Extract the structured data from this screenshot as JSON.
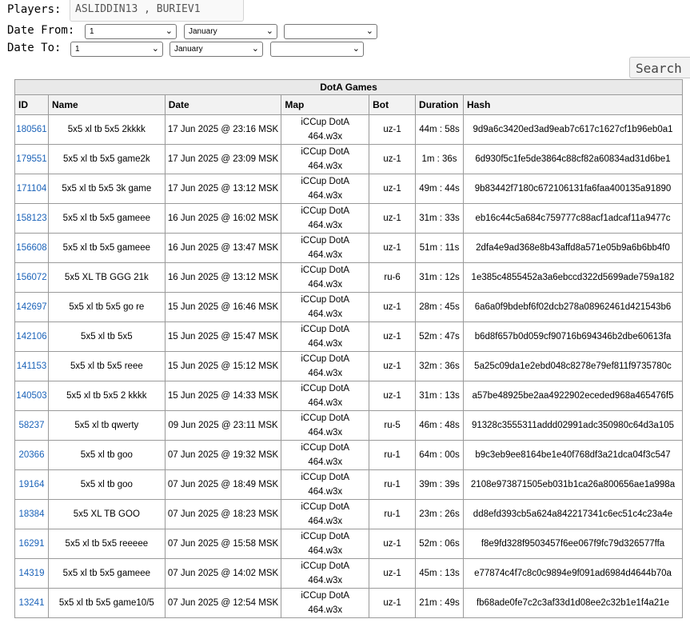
{
  "filters": {
    "players_label": "Players:",
    "players_value": "ASLIDDIN13 , BURIEV1",
    "date_from_label": "Date From:",
    "date_to_label": "Date To:",
    "from": {
      "day": "1",
      "month": "January",
      "year": ""
    },
    "to": {
      "day": "1",
      "month": "January",
      "year": ""
    },
    "search_label": "Search"
  },
  "table": {
    "caption": "DotA Games",
    "headers": [
      "ID",
      "Name",
      "Date",
      "Map",
      "Bot",
      "Duration",
      "Hash"
    ],
    "rows": [
      {
        "id": "180561",
        "name": "5x5 xl tb 5x5 2kkkk",
        "date": "17 Jun 2025 @ 23:16 MSK",
        "map1": "iCCup DotA",
        "map2": "464.w3x",
        "bot": "uz-1",
        "duration": "44m : 58s",
        "hash": "9d9a6c3420ed3ad9eab7c617c1627cf1b96eb0a1"
      },
      {
        "id": "179551",
        "name": "5x5 xl tb 5x5 game2k",
        "date": "17 Jun 2025 @ 23:09 MSK",
        "map1": "iCCup DotA",
        "map2": "464.w3x",
        "bot": "uz-1",
        "duration": "1m : 36s",
        "hash": "6d930f5c1fe5de3864c88cf82a60834ad31d6be1"
      },
      {
        "id": "171104",
        "name": "5x5 xl tb 5x5 3k game",
        "date": "17 Jun 2025 @ 13:12 MSK",
        "map1": "iCCup DotA",
        "map2": "464.w3x",
        "bot": "uz-1",
        "duration": "49m : 44s",
        "hash": "9b83442f7180c672106131fa6faa400135a91890"
      },
      {
        "id": "158123",
        "name": "5x5 xl tb 5x5 gameee",
        "date": "16 Jun 2025 @ 16:02 MSK",
        "map1": "iCCup DotA",
        "map2": "464.w3x",
        "bot": "uz-1",
        "duration": "31m : 33s",
        "hash": "eb16c44c5a684c759777c88acf1adcaf11a9477c"
      },
      {
        "id": "156608",
        "name": "5x5 xl tb 5x5 gameee",
        "date": "16 Jun 2025 @ 13:47 MSK",
        "map1": "iCCup DotA",
        "map2": "464.w3x",
        "bot": "uz-1",
        "duration": "51m : 11s",
        "hash": "2dfa4e9ad368e8b43affd8a571e05b9a6b6bb4f0"
      },
      {
        "id": "156072",
        "name": "5x5 XL TB GGG 21k",
        "date": "16 Jun 2025 @ 13:12 MSK",
        "map1": "iCCup DotA",
        "map2": "464.w3x",
        "bot": "ru-6",
        "duration": "31m : 12s",
        "hash": "1e385c4855452a3a6ebccd322d5699ade759a182"
      },
      {
        "id": "142697",
        "name": "5x5 xl tb 5x5 go re",
        "date": "15 Jun 2025 @ 16:46 MSK",
        "map1": "iCCup DotA",
        "map2": "464.w3x",
        "bot": "uz-1",
        "duration": "28m : 45s",
        "hash": "6a6a0f9bdebf6f02dcb278a08962461d421543b6"
      },
      {
        "id": "142106",
        "name": "5x5 xl tb 5x5",
        "date": "15 Jun 2025 @ 15:47 MSK",
        "map1": "iCCup DotA",
        "map2": "464.w3x",
        "bot": "uz-1",
        "duration": "52m : 47s",
        "hash": "b6d8f657b0d059cf90716b694346b2dbe60613fa"
      },
      {
        "id": "141153",
        "name": "5x5 xl tb 5x5 reee",
        "date": "15 Jun 2025 @ 15:12 MSK",
        "map1": "iCCup DotA",
        "map2": "464.w3x",
        "bot": "uz-1",
        "duration": "32m : 36s",
        "hash": "5a25c09da1e2ebd048c8278e79ef811f9735780c"
      },
      {
        "id": "140503",
        "name": "5x5 xl tb 5x5 2 kkkk",
        "date": "15 Jun 2025 @ 14:33 MSK",
        "map1": "iCCup DotA",
        "map2": "464.w3x",
        "bot": "uz-1",
        "duration": "31m : 13s",
        "hash": "a57be48925be2aa4922902eceded968a465476f5"
      },
      {
        "id": "58237",
        "name": "5x5 xl tb qwerty",
        "date": "09 Jun 2025 @ 23:11 MSK",
        "map1": "iCCup DotA",
        "map2": "464.w3x",
        "bot": "ru-5",
        "duration": "46m : 48s",
        "hash": "91328c3555311addd02991adc350980c64d3a105"
      },
      {
        "id": "20366",
        "name": "5x5 xl tb goo",
        "date": "07 Jun 2025 @ 19:32 MSK",
        "map1": "iCCup DotA",
        "map2": "464.w3x",
        "bot": "ru-1",
        "duration": "64m : 00s",
        "hash": "b9c3eb9ee8164be1e40f768df3a21dca04f3c547"
      },
      {
        "id": "19164",
        "name": "5x5 xl tb goo",
        "date": "07 Jun 2025 @ 18:49 MSK",
        "map1": "iCCup DotA",
        "map2": "464.w3x",
        "bot": "ru-1",
        "duration": "39m : 39s",
        "hash": "2108e973871505eb031b1ca26a800656ae1a998a"
      },
      {
        "id": "18384",
        "name": "5x5 XL TB GOO",
        "date": "07 Jun 2025 @ 18:23 MSK",
        "map1": "iCCup DotA",
        "map2": "464.w3x",
        "bot": "ru-1",
        "duration": "23m : 26s",
        "hash": "dd8efd393cb5a624a842217341c6ec51c4c23a4e"
      },
      {
        "id": "16291",
        "name": "5x5 xl tb 5x5 reeeee",
        "date": "07 Jun 2025 @ 15:58 MSK",
        "map1": "iCCup DotA",
        "map2": "464.w3x",
        "bot": "uz-1",
        "duration": "52m : 06s",
        "hash": "f8e9fd328f9503457f6ee067f9fc79d326577ffa"
      },
      {
        "id": "14319",
        "name": "5x5 xl tb 5x5 gameee",
        "date": "07 Jun 2025 @ 14:02 MSK",
        "map1": "iCCup DotA",
        "map2": "464.w3x",
        "bot": "uz-1",
        "duration": "45m : 13s",
        "hash": "e77874c4f7c8c0c9894e9f091ad6984d4644b70a"
      },
      {
        "id": "13241",
        "name": "5x5 xl tb 5x5 game10/5",
        "date": "07 Jun 2025 @ 12:54 MSK",
        "map1": "iCCup DotA",
        "map2": "464.w3x",
        "bot": "uz-1",
        "duration": "21m : 49s",
        "hash": "fb68ade0fe7c2c3af33d1d08ee2c32b1e1f4a21e"
      }
    ]
  }
}
